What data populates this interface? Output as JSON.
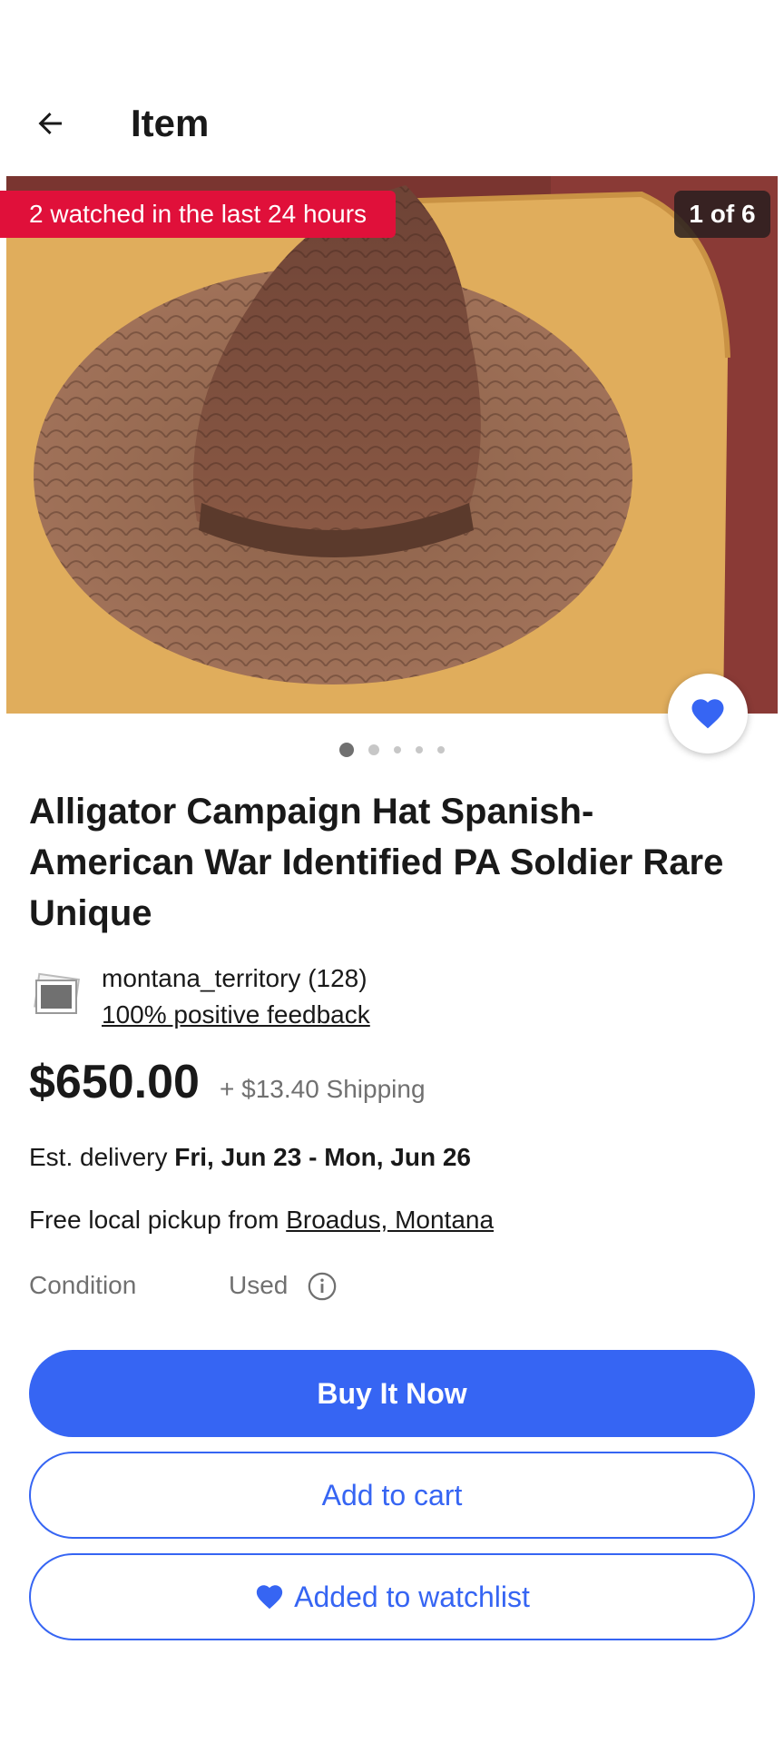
{
  "header": {
    "title": "Item",
    "back_icon": "arrow-left-icon"
  },
  "hero": {
    "watch_badge": "2 watched in the last 24 hours",
    "counter": "1 of 6",
    "favorite_icon": "heart-icon",
    "favorited": true,
    "dots_count": 5,
    "active_dot": 0
  },
  "item": {
    "title": "Alligator Campaign Hat Spanish-American War Identified PA Soldier Rare Unique"
  },
  "seller": {
    "name": "montana_territory (128)",
    "feedback": "100% positive feedback"
  },
  "pricing": {
    "price": "$650.00",
    "shipping": "+ $13.40 Shipping"
  },
  "delivery": {
    "label": "Est. delivery",
    "dates": "Fri, Jun 23 - Mon, Jun 26"
  },
  "pickup": {
    "label": "Free local pickup from",
    "location": "Broadus, Montana"
  },
  "condition": {
    "label": "Condition",
    "value": "Used",
    "info_icon": "info-icon"
  },
  "actions": {
    "buy_now": "Buy It Now",
    "add_to_cart": "Add to cart",
    "watchlist": "Added to watchlist"
  },
  "colors": {
    "accent": "#3665f3",
    "badge_red": "#e0103a",
    "text": "#191919",
    "muted": "#707070"
  }
}
